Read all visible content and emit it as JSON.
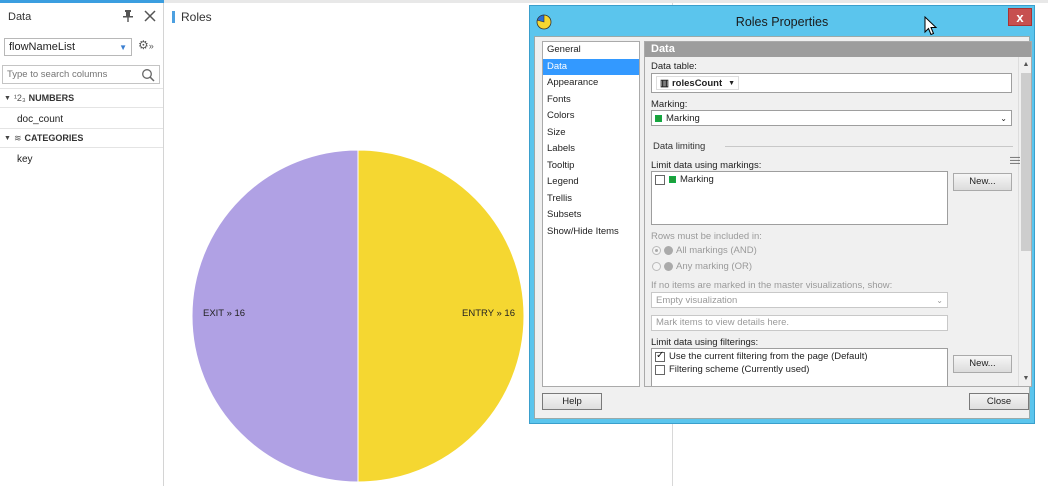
{
  "data_panel": {
    "title": "Data",
    "selected_table": "flowNameList",
    "search_placeholder": "Type to search columns",
    "groups": [
      {
        "icon_text": "¹2₃",
        "label": "NUMBERS",
        "items": [
          "doc_count"
        ]
      },
      {
        "icon_text": "≋",
        "label": "CATEGORIES",
        "items": [
          "key"
        ]
      }
    ]
  },
  "visualization": {
    "title": "Roles",
    "chart_data": {
      "type": "pie",
      "categories": [
        "EXIT",
        "ENTRY"
      ],
      "values": [
        16,
        16
      ],
      "labels": [
        "EXIT » 16",
        "ENTRY » 16"
      ],
      "colors": [
        "#b0a1e4",
        "#f5d731"
      ]
    }
  },
  "dialog": {
    "title": "Roles Properties",
    "close_label": "x",
    "nav_items": [
      "General",
      "Data",
      "Appearance",
      "Fonts",
      "Colors",
      "Size",
      "Labels",
      "Tooltip",
      "Legend",
      "Trellis",
      "Subsets",
      "Show/Hide Items"
    ],
    "active_nav": "Data",
    "section_header": "Data",
    "data_table_label": "Data table:",
    "data_table_value": "rolesCount",
    "marking_label": "Marking:",
    "marking_value": "Marking",
    "data_limiting_label": "Data limiting",
    "limit_markings_label": "Limit data using markings:",
    "markings_list": [
      {
        "label": "Marking",
        "checked": false
      }
    ],
    "new_button": "New...",
    "rows_included_label": "Rows must be included in:",
    "radio_all": "All markings (AND)",
    "radio_any": "Any marking (OR)",
    "no_items_label": "If no items are marked in the master visualizations, show:",
    "no_items_value": "Empty visualization",
    "message_value": "Mark items to view details here.",
    "limit_filterings_label": "Limit data using filterings:",
    "filterings_list": [
      {
        "label": "Use the current filtering from the page (Default)",
        "checked": true
      },
      {
        "label": "Filtering scheme (Currently used)",
        "checked": false
      }
    ],
    "new_button_2": "New...",
    "help_button": "Help",
    "close_button": "Close"
  }
}
